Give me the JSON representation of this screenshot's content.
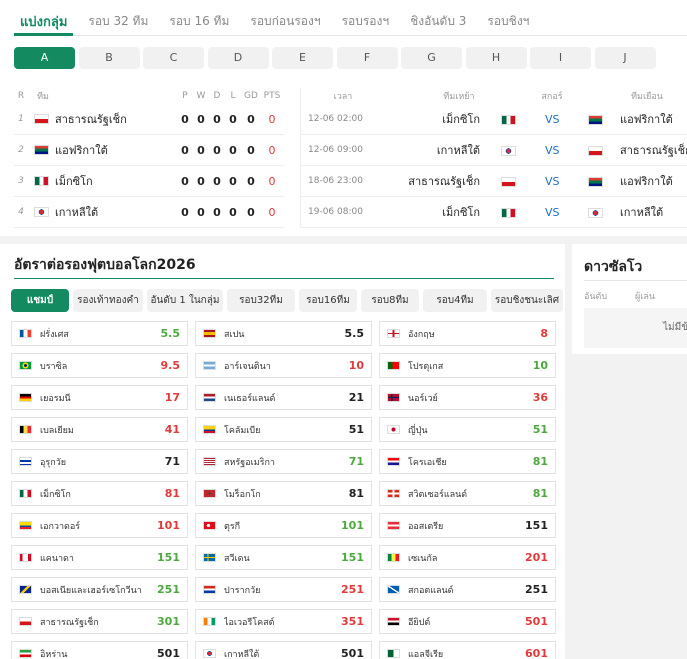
{
  "tabs": [
    "แบ่งกลุ่ม",
    "รอบ 32 ทีม",
    "รอบ 16 ทีม",
    "รอบก่อนรองฯ",
    "รอบรองฯ",
    "ชิงอันดับ 3",
    "รอบชิงฯ"
  ],
  "groups": [
    "A",
    "B",
    "C",
    "D",
    "E",
    "F",
    "G",
    "H",
    "I",
    "J"
  ],
  "standings": {
    "headers": {
      "r": "R",
      "team": "ทีม",
      "p": "P",
      "w": "W",
      "d": "D",
      "l": "L",
      "gd": "GD",
      "pts": "PTS"
    },
    "rows": [
      {
        "rank": "1",
        "team": "สาธารณรัฐเช็ก",
        "flag": "cz",
        "p": "0",
        "w": "0",
        "d": "0",
        "l": "0",
        "gd": "0",
        "pts": "0"
      },
      {
        "rank": "2",
        "team": "แอฟริกาใต้",
        "flag": "za",
        "p": "0",
        "w": "0",
        "d": "0",
        "l": "0",
        "gd": "0",
        "pts": "0"
      },
      {
        "rank": "3",
        "team": "เม็กซิโก",
        "flag": "mx",
        "p": "0",
        "w": "0",
        "d": "0",
        "l": "0",
        "gd": "0",
        "pts": "0"
      },
      {
        "rank": "4",
        "team": "เกาหลีใต้",
        "flag": "kr",
        "p": "0",
        "w": "0",
        "d": "0",
        "l": "0",
        "gd": "0",
        "pts": "0"
      }
    ]
  },
  "matches": {
    "headers": {
      "time": "เวลา",
      "home": "ทีมเหย้า",
      "score": "สกอร์",
      "away": "ทีมเยือน"
    },
    "rows": [
      {
        "time": "12-06 02:00",
        "home": "เม็กซิโก",
        "home_flag": "mx",
        "vs": "VS",
        "away": "แอฟริกาใต้",
        "away_flag": "za"
      },
      {
        "time": "12-06 09:00",
        "home": "เกาหลีใต้",
        "home_flag": "kr",
        "vs": "VS",
        "away": "สาธารณรัฐเช็ก",
        "away_flag": "cz"
      },
      {
        "time": "18-06 23:00",
        "home": "สาธารณรัฐเช็ก",
        "home_flag": "cz",
        "vs": "VS",
        "away": "แอฟริกาใต้",
        "away_flag": "za"
      },
      {
        "time": "19-06 08:00",
        "home": "เม็กซิโก",
        "home_flag": "mx",
        "vs": "VS",
        "away": "เกาหลีใต้",
        "away_flag": "kr"
      }
    ]
  },
  "odds": {
    "title": "อัตราต่อรองฟุตบอลโลก2026",
    "tabs": [
      "แชมป์",
      "รองเท้าทองคำ",
      "อันดับ 1 ในกลุ่ม",
      "รอบ32ทีม",
      "รอบ16ทีม",
      "รอบ8ทีม",
      "รอบ4ทีม",
      "รอบชิงชนะเลิศ"
    ],
    "items": [
      {
        "name": "ฝรั่งเศส",
        "flag": "fr",
        "odd": "5.5",
        "color": "green"
      },
      {
        "name": "สเปน",
        "flag": "es",
        "odd": "5.5",
        "color": "black"
      },
      {
        "name": "อังกฤษ",
        "flag": "en",
        "odd": "8",
        "color": "red"
      },
      {
        "name": "บราซิล",
        "flag": "br",
        "odd": "9.5",
        "color": "red"
      },
      {
        "name": "อาร์เจนตินา",
        "flag": "ar",
        "odd": "10",
        "color": "red"
      },
      {
        "name": "โปรตุเกส",
        "flag": "pt",
        "odd": "10",
        "color": "green"
      },
      {
        "name": "เยอรมนี",
        "flag": "de",
        "odd": "17",
        "color": "red"
      },
      {
        "name": "เนเธอร์แลนด์",
        "flag": "nl",
        "odd": "21",
        "color": "black"
      },
      {
        "name": "นอร์เวย์",
        "flag": "no",
        "odd": "36",
        "color": "red"
      },
      {
        "name": "เบลเยียม",
        "flag": "be",
        "odd": "41",
        "color": "red"
      },
      {
        "name": "โคลัมเบีย",
        "flag": "co",
        "odd": "51",
        "color": "black"
      },
      {
        "name": "ญี่ปุ่น",
        "flag": "jp",
        "odd": "51",
        "color": "green"
      },
      {
        "name": "อุรุกวัย",
        "flag": "uy",
        "odd": "71",
        "color": "black"
      },
      {
        "name": "สหรัฐอเมริกา",
        "flag": "us",
        "odd": "71",
        "color": "green"
      },
      {
        "name": "โครเอเชีย",
        "flag": "hr",
        "odd": "81",
        "color": "green"
      },
      {
        "name": "เม็กซิโก",
        "flag": "mx",
        "odd": "81",
        "color": "red"
      },
      {
        "name": "โมร็อกโก",
        "flag": "ma",
        "odd": "81",
        "color": "black"
      },
      {
        "name": "สวิตเซอร์แลนด์",
        "flag": "ch",
        "odd": "81",
        "color": "green"
      },
      {
        "name": "เอกวาดอร์",
        "flag": "ec",
        "odd": "101",
        "color": "red"
      },
      {
        "name": "ตุรกี",
        "flag": "tr",
        "odd": "101",
        "color": "green"
      },
      {
        "name": "ออสเตรีย",
        "flag": "at",
        "odd": "151",
        "color": "black"
      },
      {
        "name": "แคนาดา",
        "flag": "ca",
        "odd": "151",
        "color": "green"
      },
      {
        "name": "สวีเดน",
        "flag": "se",
        "odd": "151",
        "color": "green"
      },
      {
        "name": "เซเนกัล",
        "flag": "sn",
        "odd": "201",
        "color": "red"
      },
      {
        "name": "บอสเนียและเฮอร์เซโกวีนา",
        "flag": "ba",
        "odd": "251",
        "color": "green"
      },
      {
        "name": "ปารากวัย",
        "flag": "py",
        "odd": "251",
        "color": "red"
      },
      {
        "name": "สกอตแลนด์",
        "flag": "sc",
        "odd": "251",
        "color": "black"
      },
      {
        "name": "สาธารณรัฐเช็ก",
        "flag": "cz",
        "odd": "301",
        "color": "green"
      },
      {
        "name": "ไอเวอรีโคสต์",
        "flag": "ci",
        "odd": "351",
        "color": "red"
      },
      {
        "name": "อียิปต์",
        "flag": "eg",
        "odd": "501",
        "color": "red"
      },
      {
        "name": "อิหร่าน",
        "flag": "ir",
        "odd": "501",
        "color": "black"
      },
      {
        "name": "เกาหลีใต้",
        "flag": "kr",
        "odd": "501",
        "color": "black"
      },
      {
        "name": "แอลจีเรีย",
        "flag": "dz",
        "odd": "601",
        "color": "red"
      }
    ]
  },
  "stars": {
    "title": "ดาวซัลโว",
    "col_rank": "อันดับ",
    "col_player": "ผู้เล่น",
    "empty": "ไม่มีข้อมูล"
  },
  "colors": {
    "accent": "#138a5f",
    "odd_green": "#4caa3e",
    "odd_red": "#e03a3a",
    "vs": "#1b6fc4"
  }
}
